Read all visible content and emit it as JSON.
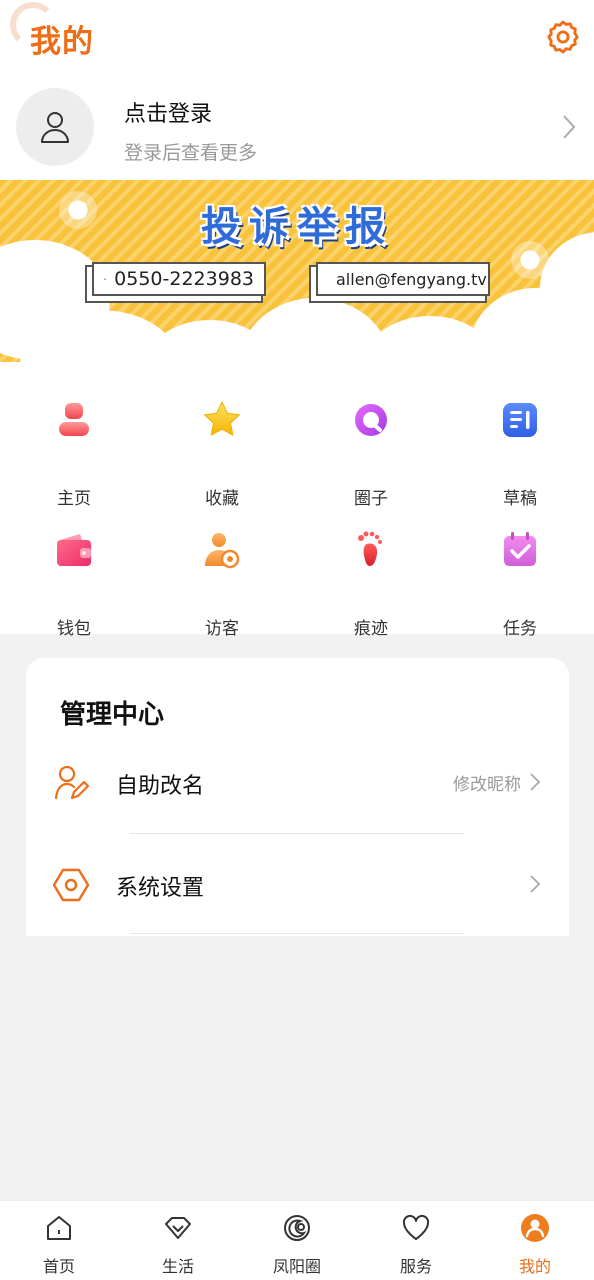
{
  "header": {
    "title": "我的",
    "settings_icon": "gear-icon",
    "accent": "#ee6d16"
  },
  "profile": {
    "title": "点击登录",
    "subtitle": "登录后查看更多"
  },
  "banner": {
    "title": "投诉举报",
    "phone": "0550-2223983",
    "email": "allen@fengyang.tv"
  },
  "grid": {
    "items": [
      {
        "label": "主页",
        "icon": "home-person-icon"
      },
      {
        "label": "收藏",
        "icon": "star-icon"
      },
      {
        "label": "圈子",
        "icon": "circle-icon"
      },
      {
        "label": "草稿",
        "icon": "draft-icon"
      },
      {
        "label": "钱包",
        "icon": "wallet-icon"
      },
      {
        "label": "访客",
        "icon": "visitor-icon"
      },
      {
        "label": "痕迹",
        "icon": "footprint-icon"
      },
      {
        "label": "任务",
        "icon": "task-icon"
      }
    ]
  },
  "management": {
    "title": "管理中心",
    "rows": [
      {
        "label": "自助改名",
        "hint": "修改昵称",
        "icon": "edit-name-icon"
      },
      {
        "label": "系统设置",
        "hint": "",
        "icon": "settings-hex-icon"
      }
    ]
  },
  "nav": {
    "items": [
      {
        "label": "首页",
        "icon": "home-icon"
      },
      {
        "label": "生活",
        "icon": "diamond-icon"
      },
      {
        "label": "凤阳圈",
        "icon": "moon-circle-icon"
      },
      {
        "label": "服务",
        "icon": "heart-icon"
      },
      {
        "label": "我的",
        "icon": "user-icon",
        "active": true
      }
    ]
  }
}
